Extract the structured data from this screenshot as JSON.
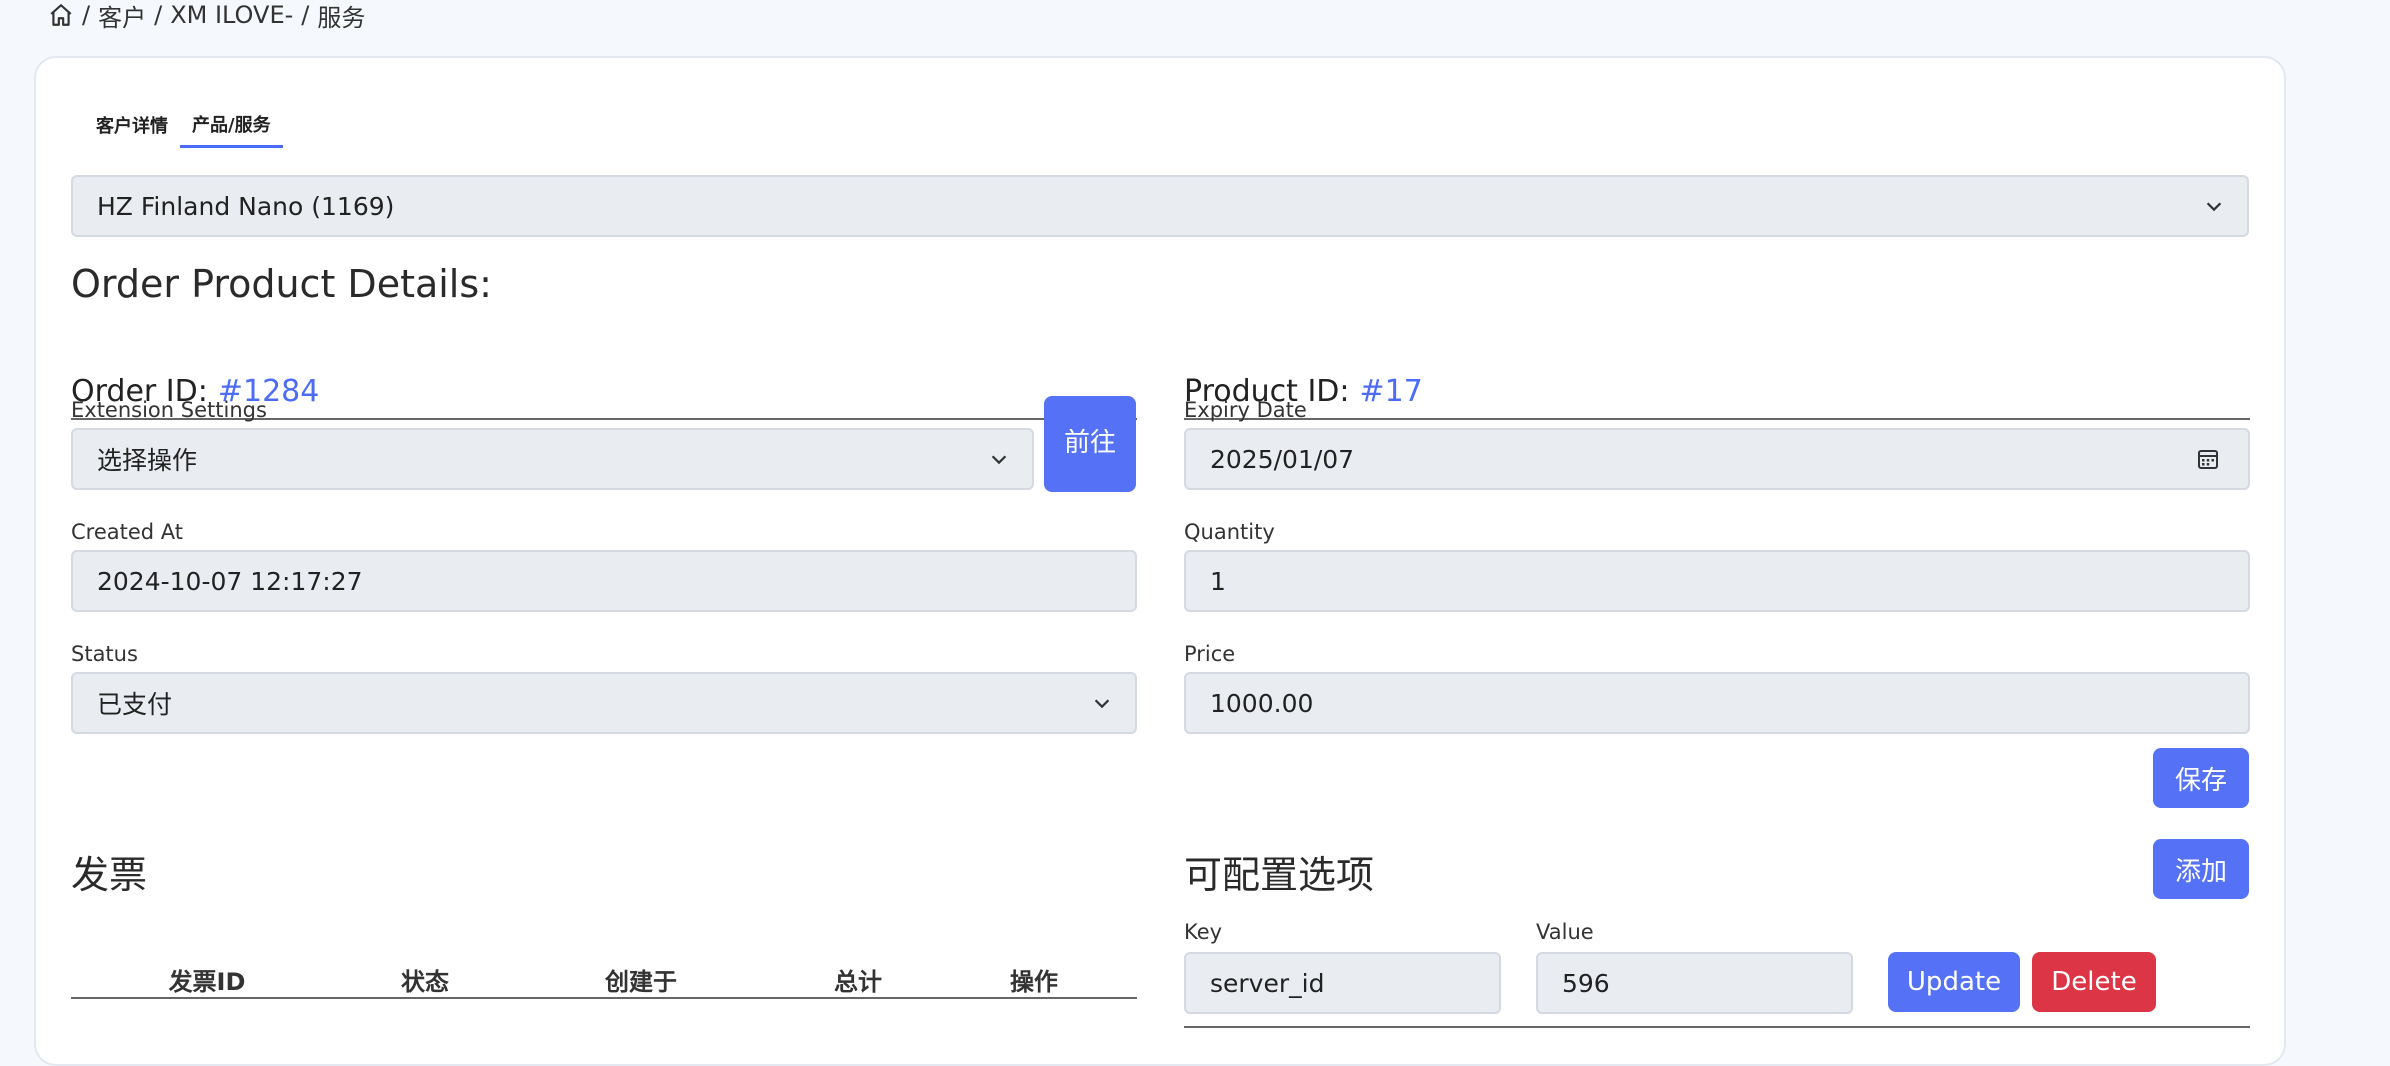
{
  "breadcrumb": {
    "items": [
      "客户",
      "XM ILOVE-",
      "服务"
    ],
    "separator": "/"
  },
  "tabs": [
    {
      "label": "客户详情",
      "active": false
    },
    {
      "label": "产品/服务",
      "active": true
    }
  ],
  "product_select": {
    "value": "HZ Finland Nano (1169)"
  },
  "order_details": {
    "title": "Order Product Details:",
    "order_id_label": "Order ID:",
    "order_id_value": "#1284",
    "product_id_label": "Product ID:",
    "product_id_value": "#17"
  },
  "extension": {
    "label": "Extension Settings",
    "value": "选择操作",
    "go_button": "前往"
  },
  "expiry": {
    "label": "Expiry Date",
    "value": "2025/01/07"
  },
  "created": {
    "label": "Created At",
    "value": "2024-10-07 12:17:27"
  },
  "quantity": {
    "label": "Quantity",
    "value": "1"
  },
  "status": {
    "label": "Status",
    "value": "已支付"
  },
  "price": {
    "label": "Price",
    "value": "1000.00"
  },
  "save_button": "保存",
  "invoices": {
    "title": "发票",
    "columns": [
      "发票ID",
      "状态",
      "创建于",
      "总计",
      "操作"
    ]
  },
  "config_options": {
    "title": "可配置选项",
    "add_button": "添加",
    "key_label": "Key",
    "value_label": "Value",
    "rows": [
      {
        "key": "server_id",
        "value": "596"
      }
    ],
    "update_button": "Update",
    "delete_button": "Delete"
  },
  "colors": {
    "accent": "#5572f7",
    "danger": "#dc3545",
    "link": "#4d6cf5"
  }
}
